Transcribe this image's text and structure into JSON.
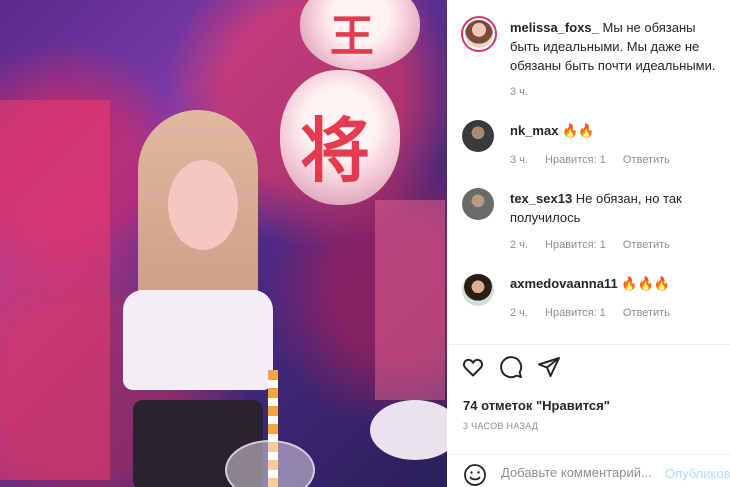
{
  "post": {
    "author": "melissa_foxs_",
    "caption": "Мы не обязаны быть идеальными. Мы даже не обязаны быть почти идеальными.",
    "caption_time": "3 ч.",
    "likes_label": "74 отметок \"Нравится\"",
    "time_ago": "3 ЧАСОВ НАЗАД"
  },
  "comments": [
    {
      "user": "nk_max",
      "text": "",
      "emoji": "🔥🔥",
      "time": "3 ч.",
      "likes": "Нравится: 1",
      "reply": "Ответить"
    },
    {
      "user": "tex_sex13",
      "text": "Не обязан, но так получилось",
      "emoji": "",
      "time": "2 ч.",
      "likes": "Нравится: 1",
      "reply": "Ответить"
    },
    {
      "user": "axmedovaanna11",
      "text": "",
      "emoji": "🔥🔥🔥",
      "time": "2 ч.",
      "likes": "Нравится: 1",
      "reply": "Ответить"
    }
  ],
  "photo_text": {
    "kanji_main": "将",
    "kanji_top": "王"
  },
  "add_comment": {
    "placeholder": "Добавьте комментарий...",
    "publish": "Опубликовать"
  },
  "icons": [
    "heart-icon",
    "comment-icon",
    "share-icon",
    "emoji-icon"
  ],
  "colors": {
    "accent": "#0095f6",
    "publish_disabled": "#b3dbff",
    "muted": "#8e8e8e",
    "text": "#262626"
  }
}
